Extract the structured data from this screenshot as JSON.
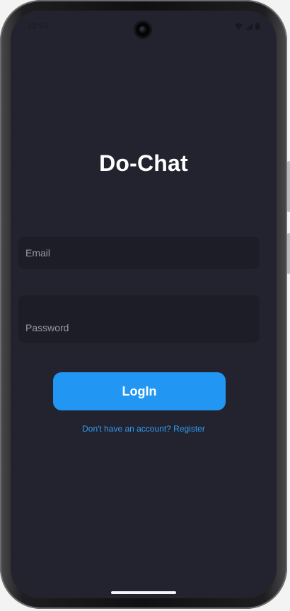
{
  "status_bar": {
    "time": "12:01",
    "icons": [
      "wifi-icon",
      "cellular-signal-icon",
      "battery-icon"
    ]
  },
  "app": {
    "title": "Do-Chat"
  },
  "form": {
    "email_placeholder": "Email",
    "email_value": "",
    "password_placeholder": "Password",
    "password_value": "",
    "login_label": "LogIn",
    "register_link": "Don't have an account? Register"
  },
  "colors": {
    "background": "#23232f",
    "field_background": "#1d1d27",
    "accent": "#2197f3",
    "link": "#2f9cf4",
    "title_text": "#ffffff"
  }
}
